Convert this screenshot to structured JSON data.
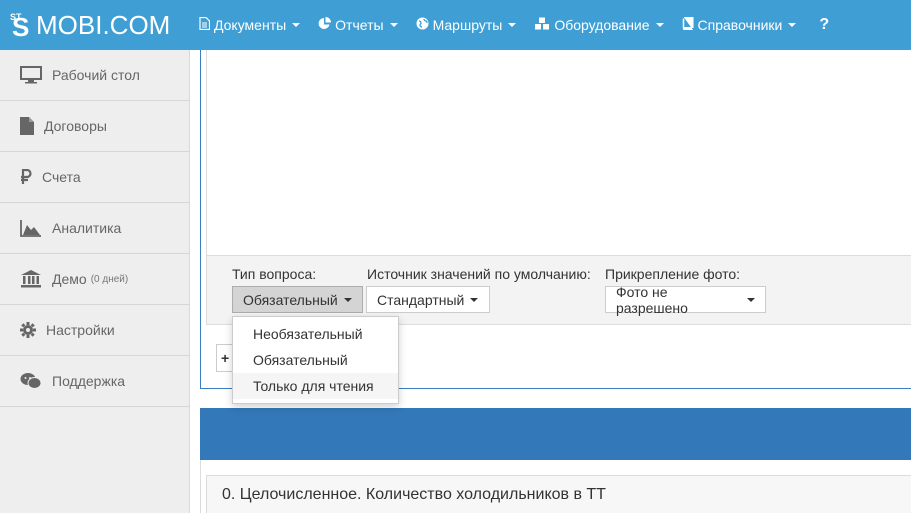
{
  "brand": {
    "logo_small": "ST",
    "logo_letter": "S",
    "name": "MOBI.COM"
  },
  "nav": {
    "items": [
      {
        "label": "Документы",
        "icon": "document-icon"
      },
      {
        "label": "Отчеты",
        "icon": "pie-chart-icon"
      },
      {
        "label": "Маршруты",
        "icon": "globe-icon"
      },
      {
        "label": "Оборудование",
        "icon": "cubes-icon"
      },
      {
        "label": "Справочники",
        "icon": "book-icon"
      }
    ],
    "help": "?"
  },
  "sidebar": {
    "items": [
      {
        "label": "Рабочий стол",
        "icon": "monitor-icon"
      },
      {
        "label": "Договоры",
        "icon": "file-icon"
      },
      {
        "label": "Счета",
        "icon": "ruble-icon"
      },
      {
        "label": "Аналитика",
        "icon": "area-chart-icon"
      },
      {
        "label": "Демо",
        "note": "(0 дней)",
        "icon": "bank-icon"
      },
      {
        "label": "Настройки",
        "icon": "gear-icon"
      },
      {
        "label": "Поддержка",
        "icon": "chat-icon"
      }
    ]
  },
  "question_settings": {
    "type_label": "Тип вопроса:",
    "type_value": "Обязательный",
    "source_label": "Источник значений по умолчанию:",
    "source_value": "Стандартный",
    "photo_label": "Прикрепление фото:",
    "photo_value": "Фото не разрешено"
  },
  "type_dropdown": {
    "options": [
      "Необязательный",
      "Обязательный",
      "Только для чтения"
    ]
  },
  "add_button": {
    "label": "+"
  },
  "question": {
    "text": "0.  Целочисленное. Количество холодильников в ТТ"
  },
  "colors": {
    "navbar": "#3f9fd4",
    "band": "#3378b9",
    "sidebar": "#eeeeee"
  }
}
